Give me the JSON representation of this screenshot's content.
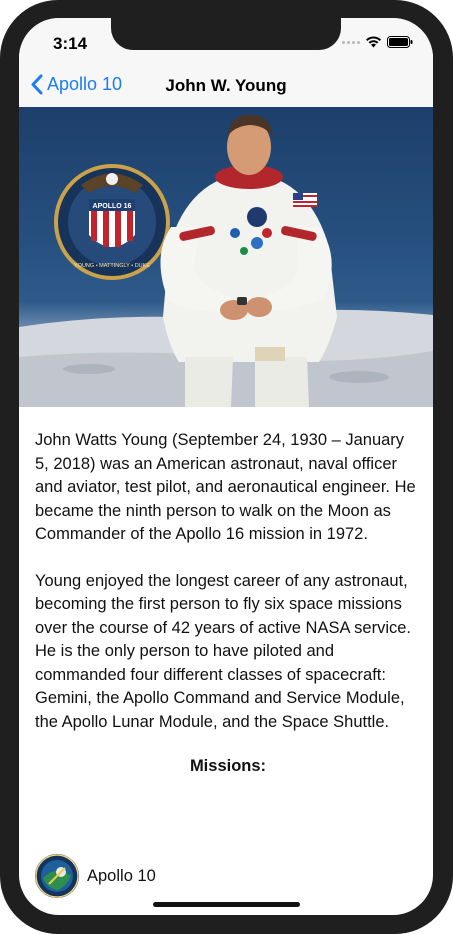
{
  "status_bar": {
    "time": "3:14"
  },
  "nav": {
    "back_label": "Apollo 10",
    "title": "John W. Young"
  },
  "hero": {
    "patch_text": "APOLLO 16",
    "patch_crew": "YOUNG • MATTINGLY • DUKE"
  },
  "bio": {
    "paragraphs": [
      "John Watts Young (September 24, 1930 – January 5, 2018) was an American astronaut, naval officer and aviator, test pilot, and aeronautical engineer. He became the ninth person to walk on the Moon as Commander of the Apollo 16 mission in 1972.",
      "Young enjoyed the longest career of any astronaut, becoming the first person to fly six space missions over the course of 42 years of active NASA service. He is the only person to have piloted and commanded four different classes of spacecraft: Gemini, the Apollo Command and Service Module, the Apollo Lunar Module, and the Space Shuttle."
    ]
  },
  "missions": {
    "heading": "Missions:",
    "items": [
      {
        "label": "Apollo 10"
      }
    ]
  },
  "colors": {
    "accent": "#1a7cf6",
    "bar_background": "#f7f7f7",
    "text": "#111111"
  }
}
